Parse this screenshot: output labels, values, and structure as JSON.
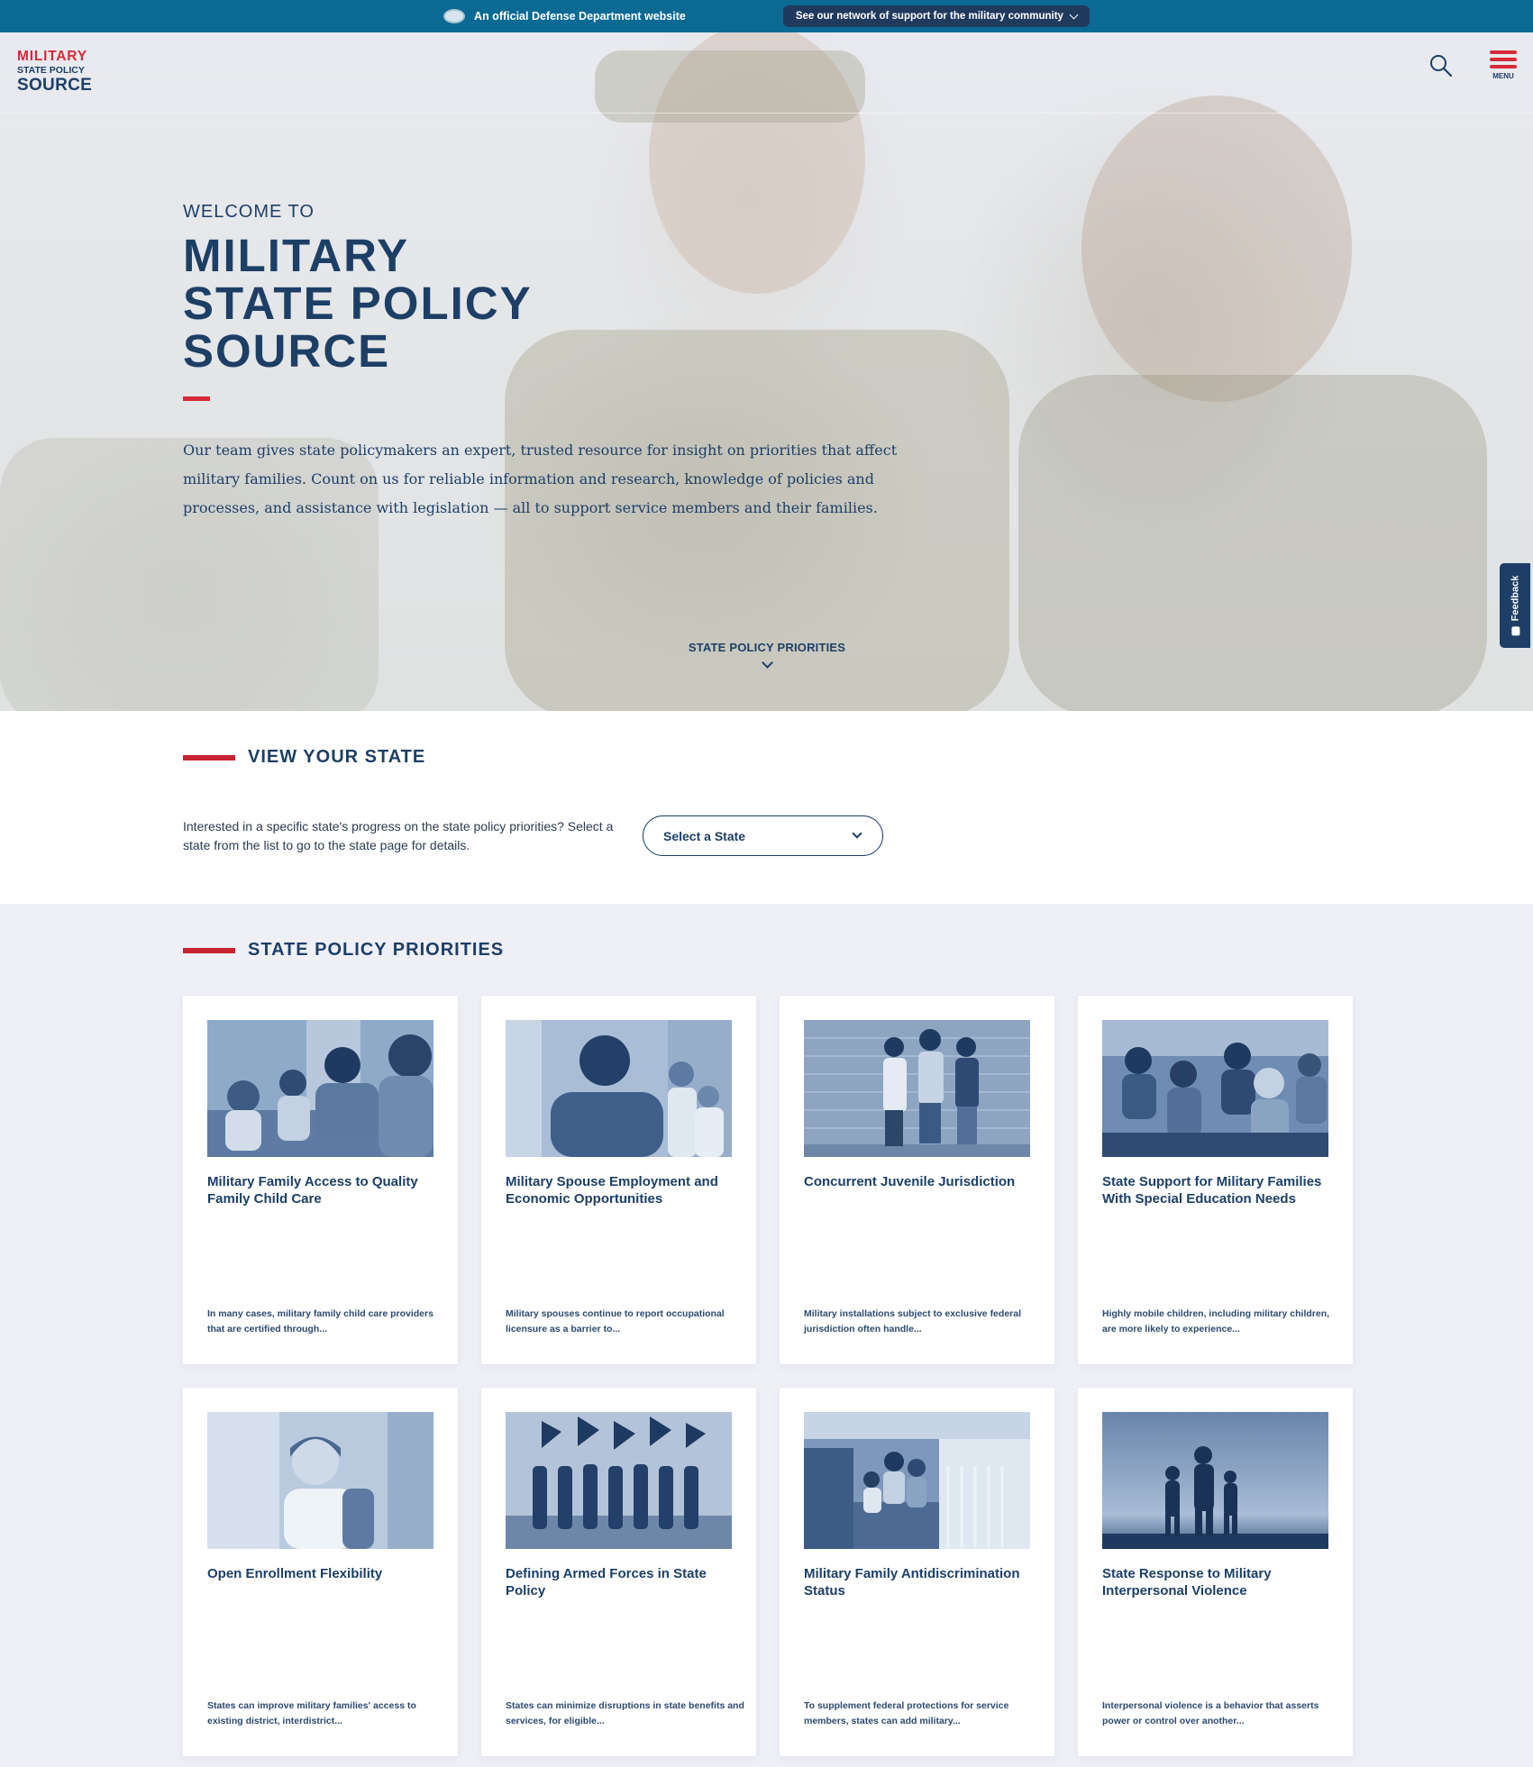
{
  "gov_banner": {
    "official_text": "An official Defense Department website",
    "network_button": "See our network of support for the military community"
  },
  "header": {
    "logo": {
      "line1": "MILITARY",
      "line2": "STATE POLICY",
      "line3": "SOURCE"
    },
    "menu_label": "MENU"
  },
  "hero": {
    "welcome": "WELCOME TO",
    "title_lines": [
      "MILITARY",
      "STATE POLICY",
      "SOURCE"
    ],
    "description": "Our team gives state policymakers an expert, trusted resource for insight on priorities that affect military families. Count on us for reliable information and research, knowledge of policies and processes, and assistance with legislation — all to support service members and their families.",
    "scroll_cue": "STATE POLICY PRIORITIES"
  },
  "feedback": {
    "label": "Feedback"
  },
  "view_state": {
    "heading": "VIEW YOUR STATE",
    "description": "Interested in a specific state's progress on the state policy priorities? Select a state from the list to go to the state page for details.",
    "select_placeholder": "Select a State"
  },
  "priorities": {
    "heading": "STATE POLICY PRIORITIES",
    "cards": [
      {
        "title": "Military Family Access to Quality Family Child Care",
        "desc": "In many cases, military family child care providers that are certified through...",
        "image": "children-playing-photo"
      },
      {
        "title": "Military Spouse Employment and Economic Opportunities",
        "desc": "Military spouses continue to report occupational licensure as a barrier to...",
        "image": "nurse-photo"
      },
      {
        "title": "Concurrent Juvenile Jurisdiction",
        "desc": "Military installations subject to exclusive federal jurisdiction often handle...",
        "image": "teens-wall-photo"
      },
      {
        "title": "State Support for Military Families With Special Education Needs",
        "desc": "Highly mobile children, including military children, are more likely to experience...",
        "image": "classroom-photo"
      },
      {
        "title": "Open Enrollment Flexibility",
        "desc": "States can improve military families' access to existing district, interdistrict...",
        "image": "schoolgirl-photo"
      },
      {
        "title": "Defining Armed Forces in State Policy",
        "desc": "States can minimize disruptions in state benefits and services, for eligible...",
        "image": "color-guard-photo"
      },
      {
        "title": "Military Family Antidiscrimination Status",
        "desc": "To supplement federal protections for service members, states can add military...",
        "image": "family-porch-photo"
      },
      {
        "title": "State Response to Military Interpersonal Violence",
        "desc": "Interpersonal violence is a behavior that asserts power or control over another...",
        "image": "silhouette-family-photo"
      }
    ]
  },
  "colors": {
    "navy": "#1d3f66",
    "red": "#d62a38",
    "banner_blue": "#0b6a94",
    "section_bg": "#eff0f6"
  }
}
